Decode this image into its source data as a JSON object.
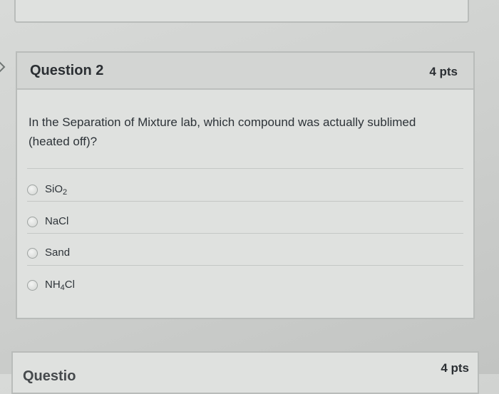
{
  "question": {
    "title": "Question 2",
    "points": "4 pts",
    "text": "In the Separation of Mixture lab, which compound was actually sublimed (heated off)?",
    "options": [
      {
        "base": "SiO",
        "sub": "2",
        "after": ""
      },
      {
        "base": "NaCl",
        "sub": "",
        "after": ""
      },
      {
        "base": "Sand",
        "sub": "",
        "after": ""
      },
      {
        "base": "NH",
        "sub": "4",
        "after": "Cl"
      }
    ]
  },
  "next_question": {
    "title": "Questio",
    "points": "4 pts"
  },
  "icons": {
    "nav": "chevron-right-icon",
    "radio": "radio-unselected-icon"
  }
}
